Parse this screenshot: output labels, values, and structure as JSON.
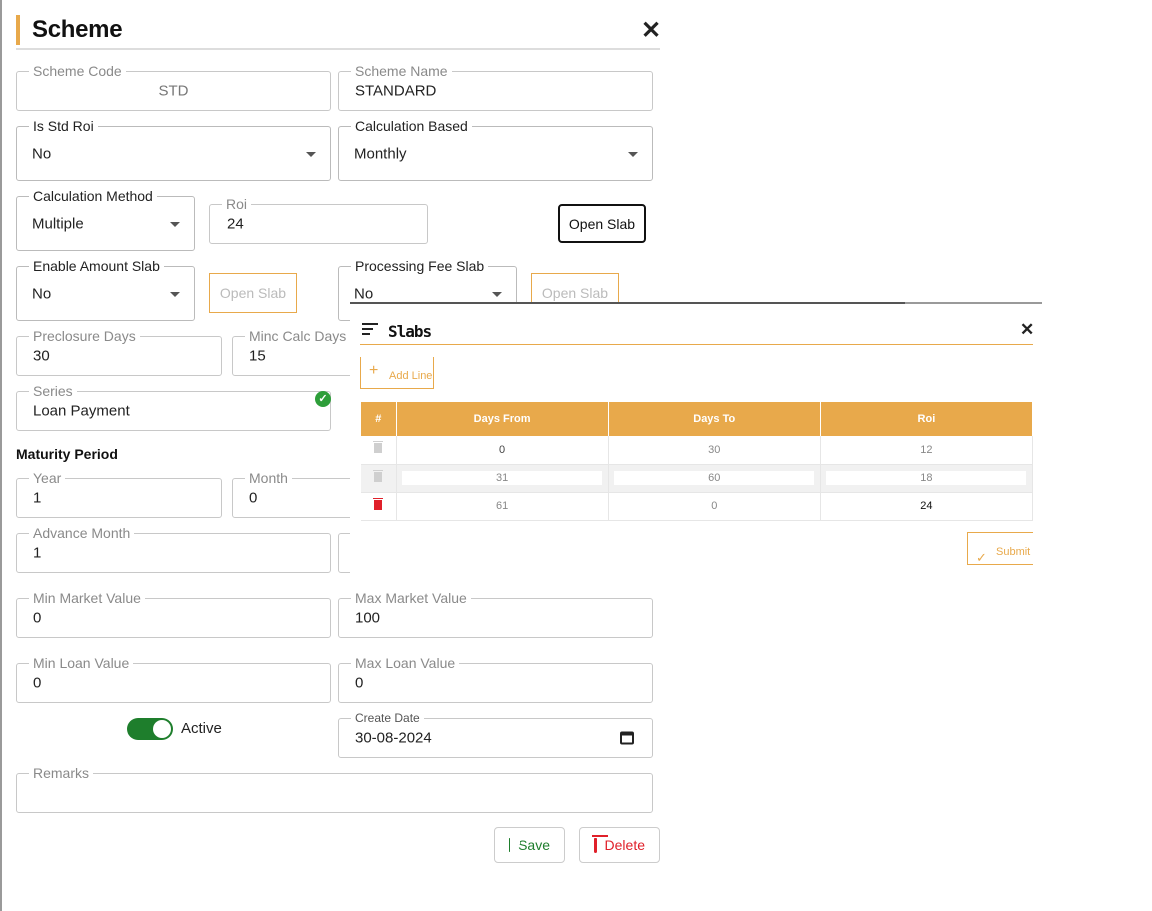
{
  "header": {
    "title": "Scheme",
    "close": "✕"
  },
  "fields": {
    "scheme_code": {
      "label": "Scheme Code",
      "value": "STD"
    },
    "scheme_name": {
      "label": "Scheme Name",
      "value": "STANDARD"
    },
    "is_std_roi": {
      "label": "Is Std Roi",
      "value": "No"
    },
    "calc_based": {
      "label": "Calculation Based",
      "value": "Monthly"
    },
    "calc_method": {
      "label": "Calculation Method",
      "value": "Multiple"
    },
    "roi": {
      "label": "Roi",
      "value": "24"
    },
    "open_slab_1": "Open Slab",
    "enable_amount_slab": {
      "label": "Enable Amount Slab",
      "value": "No"
    },
    "open_slab_2": "Open Slab",
    "processing_fee_slab": {
      "label": "Processing Fee Slab",
      "value": "No"
    },
    "open_slab_3": "Open Slab",
    "preclosure_days": {
      "label": "Preclosure Days",
      "value": "30"
    },
    "minc_calc_days": {
      "label": "Minc Calc Days",
      "value": "15"
    },
    "series": {
      "label": "Series",
      "value": "Loan Payment"
    },
    "maturity_title": "Maturity Period",
    "year": {
      "label": "Year",
      "value": "1"
    },
    "month": {
      "label": "Month",
      "value": "0"
    },
    "advance_month": {
      "label": "Advance Month",
      "value": "1"
    },
    "min_market_value": {
      "label": "Min Market Value",
      "value": "0"
    },
    "max_market_value": {
      "label": "Max Market Value",
      "value": "100"
    },
    "min_loan_value": {
      "label": "Min Loan Value",
      "value": "0"
    },
    "max_loan_value": {
      "label": "Max Loan Value",
      "value": "0"
    },
    "active": {
      "label": "Active",
      "on": true
    },
    "create_date": {
      "label": "Create Date",
      "value": "30-08-2024"
    },
    "remarks": {
      "label": "Remarks",
      "value": ""
    }
  },
  "actions": {
    "save": "Save",
    "delete": "Delete"
  },
  "slabs": {
    "title": "Slabs",
    "close": "✕",
    "add_line": "Add Line",
    "columns": [
      "#",
      "Days From",
      "Days To",
      "Roi"
    ],
    "rows": [
      {
        "from": "0",
        "to": "30",
        "roi": "12"
      },
      {
        "from": "31",
        "to": "60",
        "roi": "18"
      },
      {
        "from": "61",
        "to": "0",
        "roi": "24"
      }
    ],
    "submit": "Submit"
  },
  "colors": {
    "accent": "#e8a94b",
    "success": "#1e7e2c",
    "danger": "#e0202a"
  }
}
